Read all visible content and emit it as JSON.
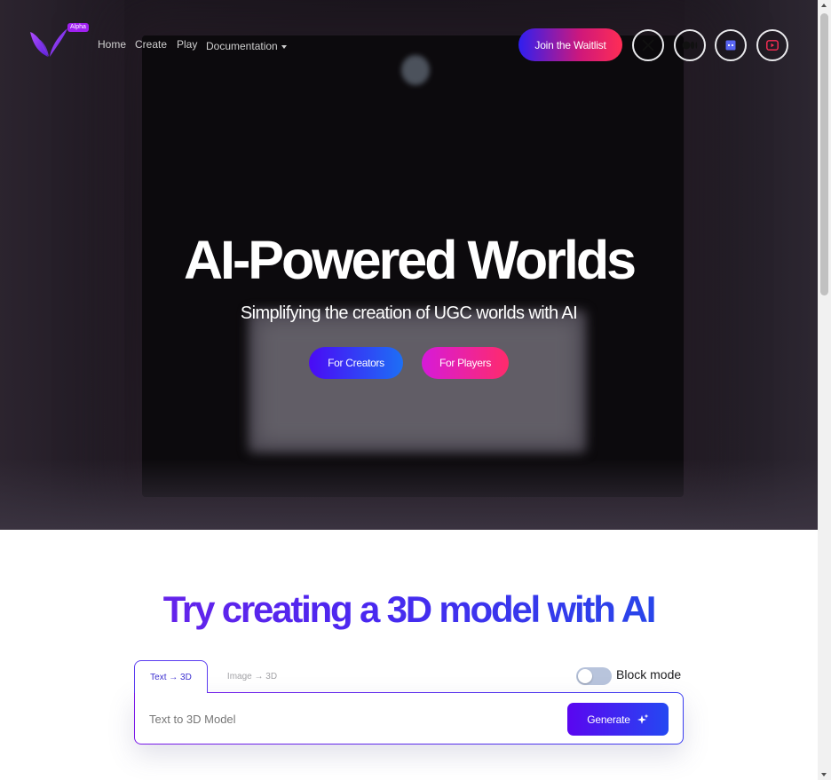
{
  "nav": {
    "alpha_badge": "Alpha",
    "links": [
      "Home",
      "Create",
      "Play",
      "Documentation"
    ],
    "waitlist_label": "Join the Waitlist",
    "socials": [
      "x-icon",
      "medium-icon",
      "discord-icon",
      "youtube-icon"
    ]
  },
  "hero": {
    "title": "AI-Powered Worlds",
    "subtitle": "Simplifying the creation of UGC worlds with AI",
    "creators_label": "For Creators",
    "players_label": "For Players"
  },
  "generator": {
    "heading": "Try creating a 3D model with AI",
    "tab_text": "Text → 3D",
    "tab_image": "Image → 3D",
    "active_tab": "Text → 3D",
    "block_mode_label": "Block mode",
    "block_mode_on": false,
    "placeholder": "Text to 3D Model",
    "generate_label": "Generate"
  },
  "colors": {
    "brand_purple": "#5a06f0",
    "brand_blue": "#2448f2",
    "brand_pink": "#ff2b6b"
  }
}
